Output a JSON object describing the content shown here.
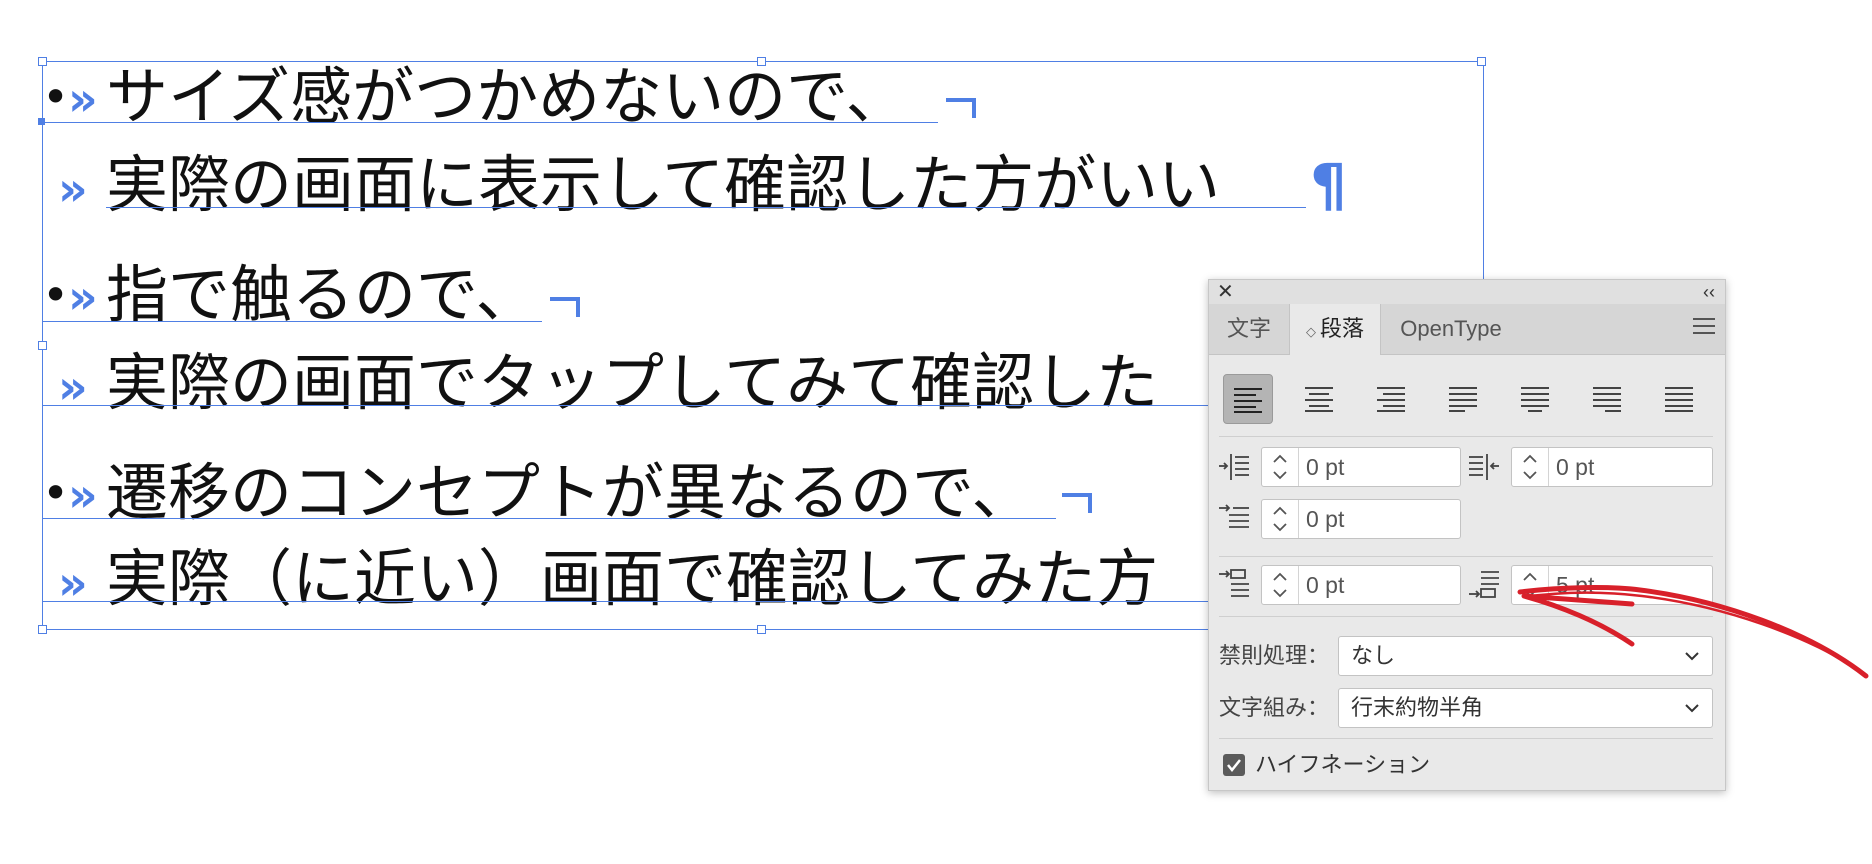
{
  "document": {
    "paragraphs": [
      {
        "line1": "サイズ感がつかめないので、",
        "line2": "実際の画面に表示して確認した方がいい"
      },
      {
        "line1": "指で触るので、",
        "line2": "実際の画面でタップしてみて確認した"
      },
      {
        "line1": "遷移のコンセプトが異なるので、",
        "line2": "実際（に近い）画面で確認してみた方"
      }
    ],
    "bullet": "•",
    "tab_mark": "»",
    "paragraph_mark": "¶",
    "guide_color": "#4f7fe4"
  },
  "panel": {
    "close_icon": "close-icon",
    "collapse_label": "‹‹",
    "tabs": [
      {
        "label": "文字"
      },
      {
        "label": "段落",
        "arrows": "◇"
      },
      {
        "label": "OpenType"
      }
    ],
    "alignment_buttons": [
      "align-left",
      "align-center",
      "align-right",
      "justify-left",
      "justify-center",
      "justify-right",
      "justify-all"
    ],
    "left_indent": "0 pt",
    "right_indent": "0 pt",
    "first_line_indent": "0 pt",
    "space_before": "0 pt",
    "space_after": "5 pt",
    "kinsoku_label": "禁則処理：",
    "kinsoku_value": "なし",
    "mojikumi_label": "文字組み：",
    "mojikumi_value": "行末約物半角",
    "hyphenation_label": "ハイフネーション",
    "hyphenation_checked": true
  },
  "annotation": {
    "arrow_color": "#d8202a"
  }
}
